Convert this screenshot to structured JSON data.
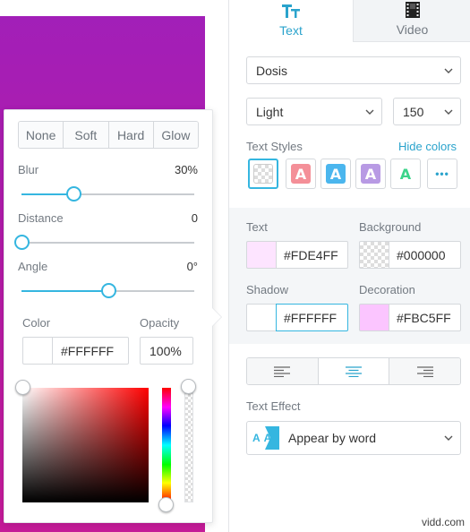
{
  "popup": {
    "shadow_types": [
      "None",
      "Soft",
      "Hard",
      "Glow"
    ],
    "blur": {
      "label": "Blur",
      "value_text": "30%",
      "fraction": 0.3
    },
    "distance": {
      "label": "Distance",
      "value_text": "0",
      "fraction": 0.0
    },
    "angle": {
      "label": "Angle",
      "value_text": "0°",
      "fraction": 0.5
    },
    "color_label": "Color",
    "opacity_label": "Opacity",
    "color_hex": "#FFFFFF",
    "opacity_value": "100%"
  },
  "panel": {
    "tabs": {
      "text": "Text",
      "video": "Video"
    },
    "font_family": "Dosis",
    "font_weight": "Light",
    "font_size": "150",
    "text_styles_label": "Text Styles",
    "hide_colors_link": "Hide colors",
    "style_letter": "A",
    "more_label": "•••",
    "colors": {
      "text": {
        "label": "Text",
        "hex": "#FDE4FF",
        "swatch": "#FDE4FF"
      },
      "background": {
        "label": "Background",
        "hex": "#000000"
      },
      "shadow": {
        "label": "Shadow",
        "hex": "#FFFFFF",
        "swatch": "#FFFFFF"
      },
      "decoration": {
        "label": "Decoration",
        "hex": "#FBC5FF",
        "swatch": "#FBC5FF"
      }
    },
    "text_effect_label": "Text Effect",
    "text_effect_value": "Appear by word",
    "effect_icon_letters": "AA"
  },
  "watermark": "vidd.com",
  "accent_color": "#35B6E0"
}
